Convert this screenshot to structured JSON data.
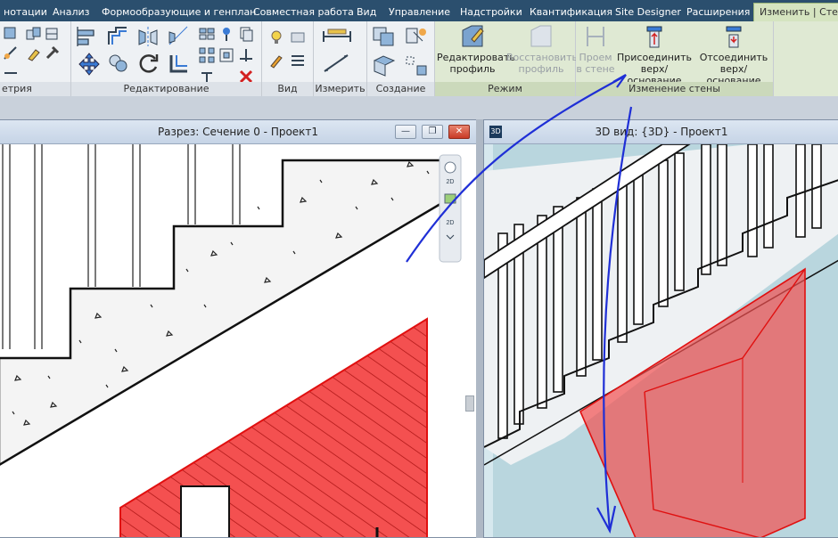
{
  "ribbon": {
    "tabs": [
      {
        "label": "нотации",
        "active": false
      },
      {
        "label": "Анализ",
        "active": false
      },
      {
        "label": "Формообразующие и генплан",
        "active": false
      },
      {
        "label": "Совместная работа",
        "active": false
      },
      {
        "label": "Вид",
        "active": false
      },
      {
        "label": "Управление",
        "active": false
      },
      {
        "label": "Надстройки",
        "active": false
      },
      {
        "label": "Квантификация",
        "active": false
      },
      {
        "label": "Site Designer",
        "active": false
      },
      {
        "label": "Расширения",
        "active": false
      },
      {
        "label": "Изменить | Стены",
        "active": true
      }
    ],
    "panels": {
      "geometry": "етрия",
      "edit": "Редактирование",
      "view": "Вид",
      "measure": "Измерить",
      "create": "Создание",
      "mode": "Режим",
      "wall_edit": "Изменение стены"
    },
    "buttons": {
      "edit_profile": [
        "Редактировать",
        "профиль"
      ],
      "restore_profile": [
        "Восстановить",
        "профиль"
      ],
      "wall_opening": [
        "Проем",
        "в стене"
      ],
      "attach_top_base": [
        "Присоединить",
        "верх/основание"
      ],
      "detach_top_base": [
        "Отсоединить",
        "верх/основание"
      ]
    }
  },
  "views": {
    "section": {
      "title": "Разрез: Сечение 0 - Проект1",
      "nav_labels": [
        "2D",
        "2D"
      ]
    },
    "three_d": {
      "title": "3D вид: {3D} - Проект1"
    }
  },
  "window_buttons": {
    "minimize": "—",
    "restore": "❐",
    "close": "✕"
  },
  "colors": {
    "ribbon_tab_bar": "#2b4f6e",
    "active_tab": "#d5e4c0",
    "wall_fill": "#f43b3b",
    "annotation_arrow": "#1f2fd6",
    "view_3d_background": "#b9d6de"
  }
}
